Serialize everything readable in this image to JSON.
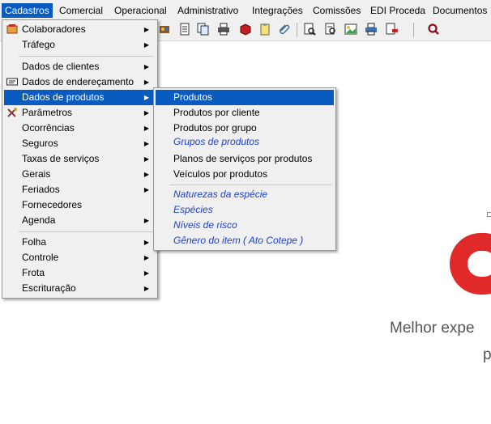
{
  "menubar": {
    "items": [
      "Cadastros",
      "Comercial",
      "Operacional",
      "Administrativo",
      "Integrações",
      "Comissões",
      "EDI Proceda",
      "Documentos"
    ]
  },
  "toolbar": {
    "icons": [
      "palette-icon",
      "document-icon",
      "copy-icon",
      "printer-icon",
      "cube-icon",
      "clipboard-icon",
      "attachment-icon",
      "preview-icon",
      "report-icon",
      "image-icon",
      "print-preview-icon",
      "export-icon",
      "search-icon"
    ]
  },
  "cadastros_menu": {
    "items": [
      {
        "label": "Colaboradores",
        "icon": "users-icon",
        "submenu": true
      },
      {
        "label": "Tráfego",
        "submenu": true
      },
      {
        "label": "Dados de clientes",
        "submenu": true
      },
      {
        "label": "Dados de endereçamento",
        "icon": "address-card-icon",
        "submenu": true
      },
      {
        "label": "Dados de produtos",
        "submenu": true,
        "selected": true
      },
      {
        "label": "Parâmetros",
        "icon": "tools-icon",
        "submenu": true
      },
      {
        "label": "Ocorrências",
        "submenu": true
      },
      {
        "label": "Seguros",
        "submenu": true
      },
      {
        "label": "Taxas de serviços",
        "submenu": true
      },
      {
        "label": "Gerais",
        "submenu": true
      },
      {
        "label": "Feriados",
        "submenu": true
      },
      {
        "label": "Fornecedores",
        "submenu": false
      },
      {
        "label": "Agenda",
        "submenu": true
      },
      {
        "label": "Folha",
        "submenu": true
      },
      {
        "label": "Controle",
        "submenu": true
      },
      {
        "label": "Frota",
        "submenu": true
      },
      {
        "label": "Escrituração",
        "submenu": true
      }
    ]
  },
  "produtos_submenu": {
    "items": [
      {
        "label": "Produtos",
        "selected": true
      },
      {
        "label": "Produtos por cliente"
      },
      {
        "label": "Produtos por grupo"
      },
      {
        "label": "Grupos de produtos",
        "italic": true
      },
      {
        "label": "Planos de serviços por produtos"
      },
      {
        "label": "Veículos por produtos"
      },
      {
        "label": "Naturezas da espécie",
        "italic": true
      },
      {
        "label": "Espécies",
        "italic": true
      },
      {
        "label": "Níveis de risco",
        "italic": true
      },
      {
        "label": "Gênero do item ( Ato Cotepe )",
        "italic": true
      }
    ]
  },
  "content": {
    "welcome_line1": "Melhor expe",
    "welcome_line2": "p"
  },
  "colors": {
    "highlight": "#0a5bbf",
    "italic_link": "#1a3fd1",
    "logo_red": "#e02a2a"
  }
}
